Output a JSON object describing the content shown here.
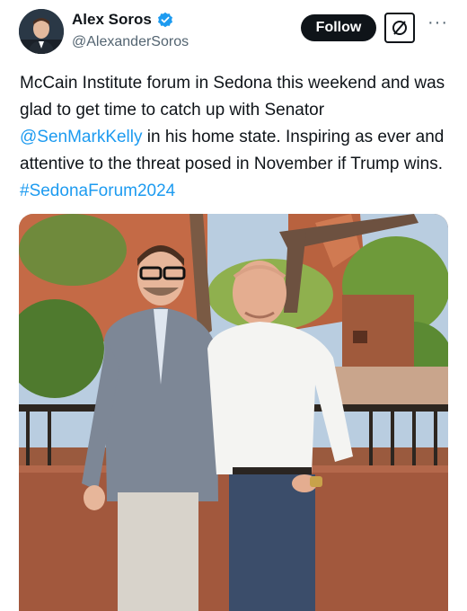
{
  "author": {
    "display_name": "Alex Soros",
    "handle": "@AlexanderSoros",
    "verified": true
  },
  "actions": {
    "follow_label": "Follow",
    "grok_icon": "grok-slash-icon",
    "more_icon": "more-dots-icon",
    "more_glyph": "···"
  },
  "tweet": {
    "text_1": "McCain Institute forum in Sedona this weekend and was glad to get time to catch up with Senator ",
    "mention": "@SenMarkKelly",
    "text_2": " in his home state. Inspiring as ever and attentive to the threat posed in November if Trump wins. ",
    "hashtag": "#SedonaForum2024"
  },
  "colors": {
    "link": "#1d9bf0",
    "verified": "#1d9bf0",
    "follow_bg": "#0f1419"
  }
}
